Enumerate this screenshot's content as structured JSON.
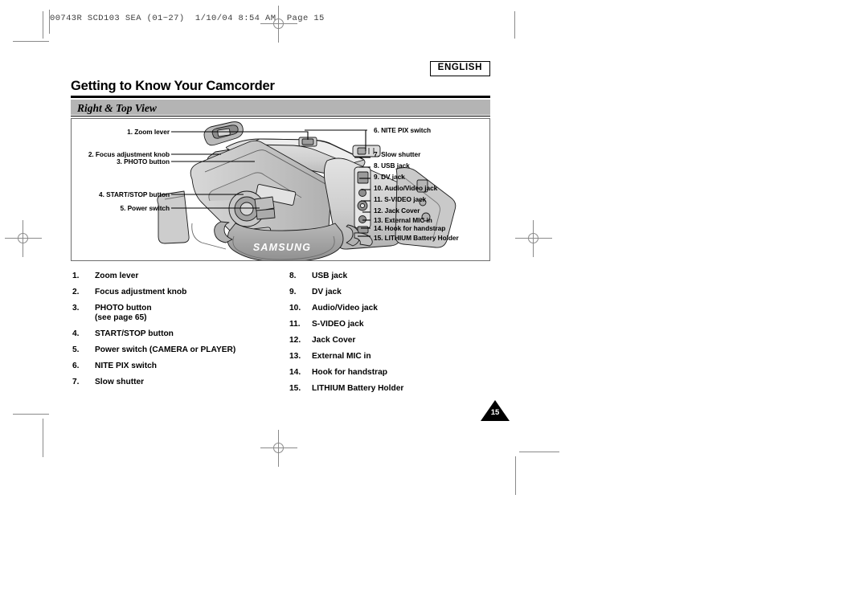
{
  "printer_slug": {
    "text": "00743R SCD103 SEA (01~27)  1/10/04 8:54 AM  Page 15"
  },
  "header": {
    "language_badge": "ENGLISH",
    "chapter_title": "Getting to Know Your Camcorder",
    "section_title": "Right & Top View"
  },
  "illustration": {
    "brand_text": "SAMSUNG",
    "callouts_left": [
      {
        "id": "1",
        "label": "1. Zoom lever"
      },
      {
        "id": "2",
        "label": "2. Focus adjustment knob"
      },
      {
        "id": "3",
        "label": "3. PHOTO button"
      },
      {
        "id": "4",
        "label": "4. START/STOP button"
      },
      {
        "id": "5",
        "label": "5. Power switch"
      }
    ],
    "callouts_right": [
      {
        "id": "6",
        "label": "6. NITE PIX switch"
      },
      {
        "id": "7",
        "label": "7. Slow shutter"
      },
      {
        "id": "8",
        "label": "8. USB jack"
      },
      {
        "id": "9",
        "label": "9. DV jack"
      },
      {
        "id": "10",
        "label": "10. Audio/Video jack"
      },
      {
        "id": "11",
        "label": "11. S-VIDEO jack"
      },
      {
        "id": "12",
        "label": "12. Jack Cover"
      },
      {
        "id": "13",
        "label": "13. External MIC in"
      },
      {
        "id": "14",
        "label": "14. Hook for handstrap"
      },
      {
        "id": "15",
        "label": "15. LITHIUM Battery Holder"
      }
    ]
  },
  "legend": {
    "column_left": [
      {
        "num": "1.",
        "label": "Zoom lever",
        "sub": ""
      },
      {
        "num": "2.",
        "label": "Focus adjustment knob",
        "sub": ""
      },
      {
        "num": "3.",
        "label": "PHOTO button",
        "sub": "(see page 65)"
      },
      {
        "num": "4.",
        "label": "START/STOP button",
        "sub": ""
      },
      {
        "num": "5.",
        "label": "Power switch (CAMERA or PLAYER)",
        "sub": ""
      },
      {
        "num": "6.",
        "label": "NITE PIX switch",
        "sub": ""
      },
      {
        "num": "7.",
        "label": "Slow shutter",
        "sub": ""
      }
    ],
    "column_right": [
      {
        "num": "8.",
        "label": "USB jack",
        "sub": ""
      },
      {
        "num": "9.",
        "label": "DV jack",
        "sub": ""
      },
      {
        "num": "10.",
        "label": "Audio/Video jack",
        "sub": ""
      },
      {
        "num": "11.",
        "label": "S-VIDEO jack",
        "sub": ""
      },
      {
        "num": "12.",
        "label": "Jack Cover",
        "sub": ""
      },
      {
        "num": "13.",
        "label": "External MIC in",
        "sub": ""
      },
      {
        "num": "14.",
        "label": "Hook for handstrap",
        "sub": ""
      },
      {
        "num": "15.",
        "label": "LITHIUM Battery Holder",
        "sub": ""
      }
    ]
  },
  "folio": {
    "page_number": "15"
  },
  "colors": {
    "section_bar": "#b4b4b4",
    "rule": "#000000",
    "crop_mark": "#8a8a8a",
    "illo_body": "#d2d2d2",
    "illo_shade": "#a9a9a9"
  }
}
